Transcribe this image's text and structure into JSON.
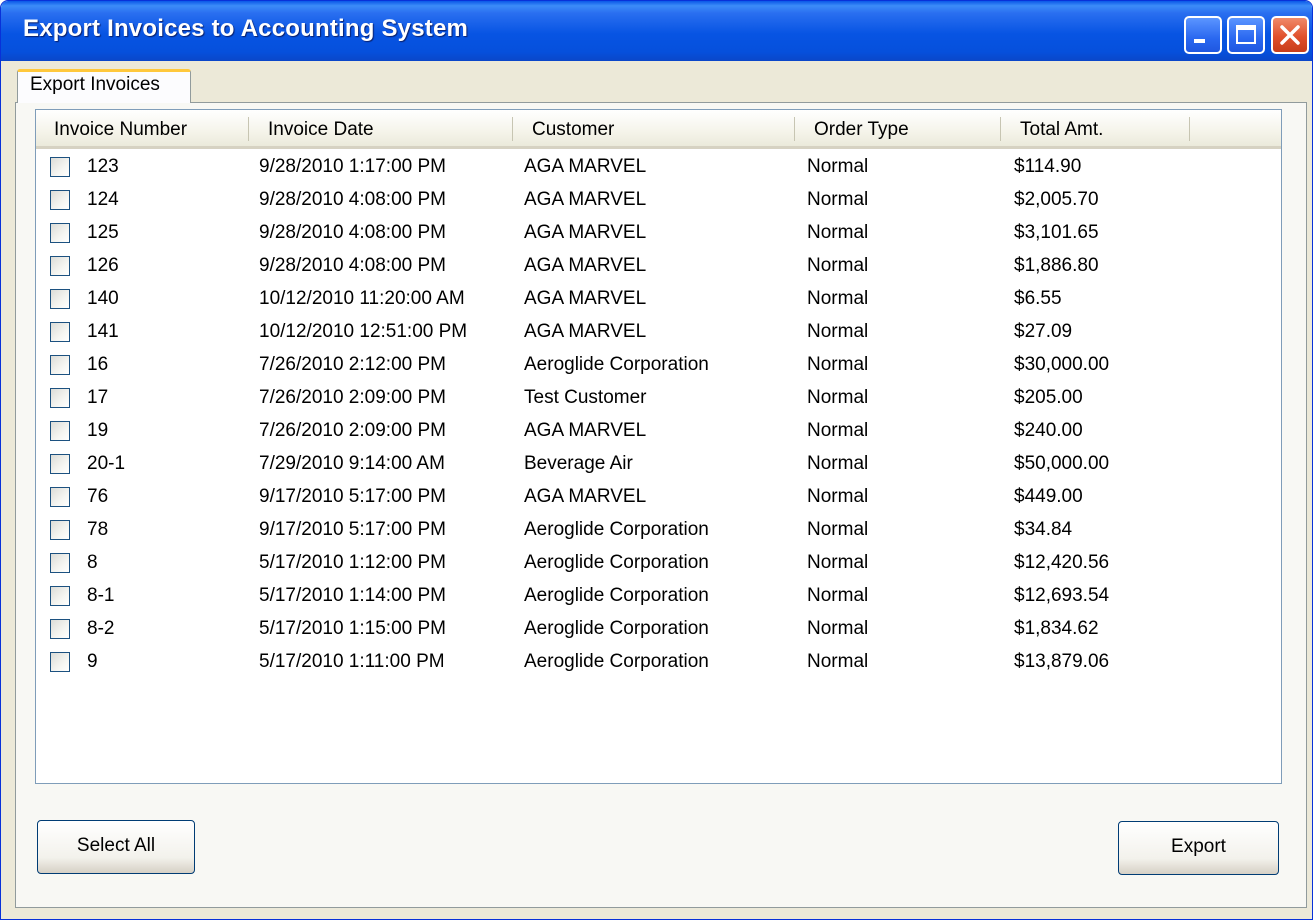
{
  "window": {
    "title": "Export Invoices to Accounting System",
    "controls": [
      "minimize-icon",
      "maximize-icon",
      "close-icon"
    ]
  },
  "tabs": [
    {
      "label": "Export Invoices",
      "selected": true
    }
  ],
  "table": {
    "columns": [
      "Invoice Number",
      "Invoice Date",
      "Customer",
      "Order Type",
      "Total Amt."
    ],
    "rows": [
      {
        "checked": false,
        "invoice_number": "123",
        "invoice_date": "9/28/2010 1:17:00 PM",
        "customer": "AGA MARVEL",
        "order_type": "Normal",
        "total": "$114.90"
      },
      {
        "checked": false,
        "invoice_number": "124",
        "invoice_date": "9/28/2010 4:08:00 PM",
        "customer": "AGA MARVEL",
        "order_type": "Normal",
        "total": "$2,005.70"
      },
      {
        "checked": false,
        "invoice_number": "125",
        "invoice_date": "9/28/2010 4:08:00 PM",
        "customer": "AGA MARVEL",
        "order_type": "Normal",
        "total": "$3,101.65"
      },
      {
        "checked": false,
        "invoice_number": "126",
        "invoice_date": "9/28/2010 4:08:00 PM",
        "customer": "AGA MARVEL",
        "order_type": "Normal",
        "total": "$1,886.80"
      },
      {
        "checked": false,
        "invoice_number": "140",
        "invoice_date": "10/12/2010 11:20:00 AM",
        "customer": "AGA MARVEL",
        "order_type": "Normal",
        "total": "$6.55"
      },
      {
        "checked": false,
        "invoice_number": "141",
        "invoice_date": "10/12/2010 12:51:00 PM",
        "customer": "AGA MARVEL",
        "order_type": "Normal",
        "total": "$27.09"
      },
      {
        "checked": false,
        "invoice_number": "16",
        "invoice_date": "7/26/2010 2:12:00 PM",
        "customer": "Aeroglide Corporation",
        "order_type": "Normal",
        "total": "$30,000.00"
      },
      {
        "checked": false,
        "invoice_number": "17",
        "invoice_date": "7/26/2010 2:09:00 PM",
        "customer": "Test Customer",
        "order_type": "Normal",
        "total": "$205.00"
      },
      {
        "checked": false,
        "invoice_number": "19",
        "invoice_date": "7/26/2010 2:09:00 PM",
        "customer": "AGA MARVEL",
        "order_type": "Normal",
        "total": "$240.00"
      },
      {
        "checked": false,
        "invoice_number": "20-1",
        "invoice_date": "7/29/2010 9:14:00 AM",
        "customer": "Beverage Air",
        "order_type": "Normal",
        "total": "$50,000.00"
      },
      {
        "checked": false,
        "invoice_number": "76",
        "invoice_date": "9/17/2010 5:17:00 PM",
        "customer": "AGA MARVEL",
        "order_type": "Normal",
        "total": "$449.00"
      },
      {
        "checked": false,
        "invoice_number": "78",
        "invoice_date": "9/17/2010 5:17:00 PM",
        "customer": "Aeroglide Corporation",
        "order_type": "Normal",
        "total": "$34.84"
      },
      {
        "checked": false,
        "invoice_number": "8",
        "invoice_date": "5/17/2010 1:12:00 PM",
        "customer": "Aeroglide Corporation",
        "order_type": "Normal",
        "total": "$12,420.56"
      },
      {
        "checked": false,
        "invoice_number": "8-1",
        "invoice_date": "5/17/2010 1:14:00 PM",
        "customer": "Aeroglide Corporation",
        "order_type": "Normal",
        "total": "$12,693.54"
      },
      {
        "checked": false,
        "invoice_number": "8-2",
        "invoice_date": "5/17/2010 1:15:00 PM",
        "customer": "Aeroglide Corporation",
        "order_type": "Normal",
        "total": "$1,834.62"
      },
      {
        "checked": false,
        "invoice_number": "9",
        "invoice_date": "5/17/2010 1:11:00 PM",
        "customer": "Aeroglide Corporation",
        "order_type": "Normal",
        "total": "$13,879.06"
      }
    ]
  },
  "buttons": {
    "select_all": "Select All",
    "export": "Export"
  }
}
